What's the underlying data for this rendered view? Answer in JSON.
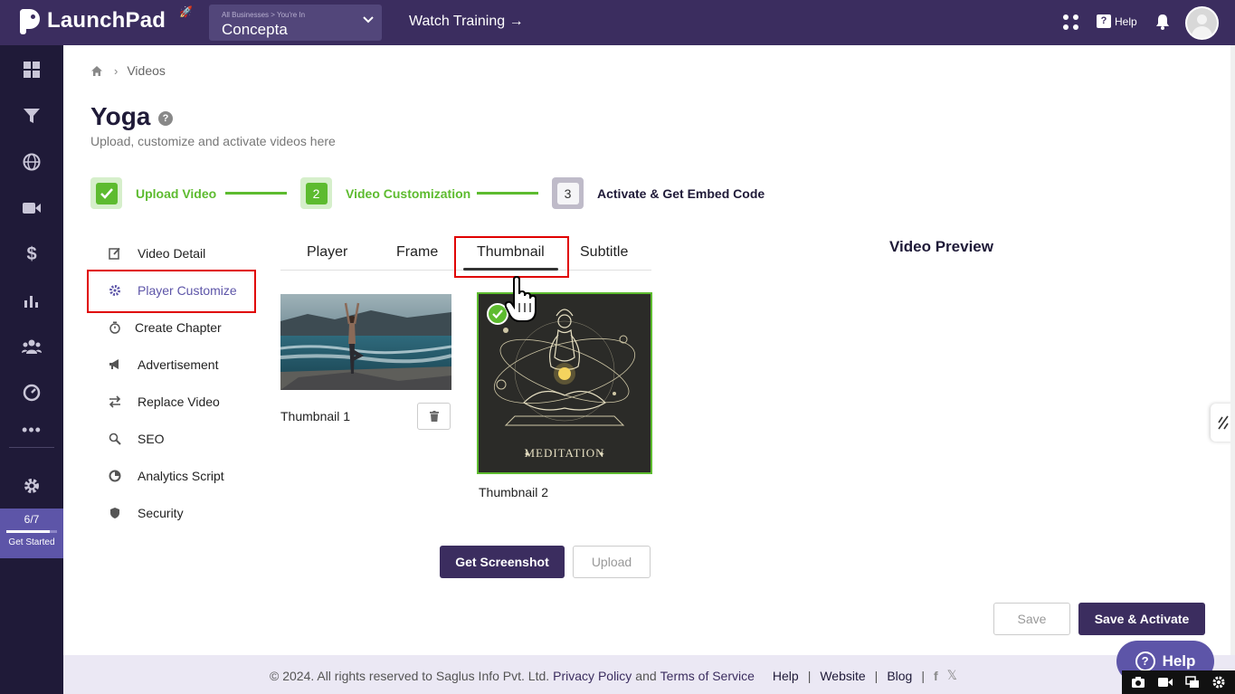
{
  "app": {
    "logo_text": "LaunchPad",
    "business_crumb": "All Businesses > You're In",
    "business_name": "Concepta",
    "watch_training": "Watch Training →",
    "help_label": "Help"
  },
  "sidebar": {
    "icons": [
      "dashboard-icon",
      "funnel-icon",
      "globe-icon",
      "video-icon",
      "dollar-icon",
      "analytics-icon",
      "users-icon",
      "gauge-icon",
      "more-icon",
      "gear-icon"
    ],
    "get_started_count": "6/7",
    "get_started_label": "Get Started",
    "get_started_progress": 0.857
  },
  "breadcrumb": {
    "current": "Videos"
  },
  "page": {
    "title": "Yoga",
    "subtitle": "Upload, customize and activate videos here"
  },
  "steps": [
    {
      "label": "Upload Video",
      "state": "done"
    },
    {
      "label": "Video Customization",
      "number": "2",
      "state": "active"
    },
    {
      "label": "Activate & Get Embed Code",
      "number": "3",
      "state": "pending"
    }
  ],
  "menu": [
    {
      "label": "Video Detail",
      "icon": "edit-icon"
    },
    {
      "label": "Player Customize",
      "icon": "settings-icon",
      "active": true
    },
    {
      "label": "Create Chapter",
      "icon": "timer-icon"
    },
    {
      "label": "Advertisement",
      "icon": "megaphone-icon"
    },
    {
      "label": "Replace Video",
      "icon": "swap-icon"
    },
    {
      "label": "SEO",
      "icon": "search-icon"
    },
    {
      "label": "Analytics Script",
      "icon": "pie-icon"
    },
    {
      "label": "Security",
      "icon": "shield-icon"
    }
  ],
  "tabs": [
    "Player",
    "Frame",
    "Thumbnail",
    "Subtitle"
  ],
  "active_tab": "Thumbnail",
  "thumbnails": [
    {
      "label": "Thumbnail 1",
      "selected": false
    },
    {
      "label": "Thumbnail 2",
      "selected": true,
      "art_text": "MEDITATION"
    }
  ],
  "buttons": {
    "get_screenshot": "Get Screenshot",
    "upload": "Upload",
    "save": "Save",
    "save_activate": "Save & Activate"
  },
  "preview": {
    "title": "Video Preview"
  },
  "footer": {
    "copyright": "©  2024. All rights reserved to Saglus Info Pvt. Ltd.",
    "privacy": "Privacy Policy",
    "and": "and",
    "terms": "Terms of Service",
    "help": "Help",
    "website": "Website",
    "blog": "Blog"
  },
  "help_fab": "Help",
  "colors": {
    "brand": "#3b2d5f",
    "sidebar": "#1f1a38",
    "success": "#5dbb2f",
    "highlight": "#e00000",
    "accent": "#5d55a8"
  }
}
